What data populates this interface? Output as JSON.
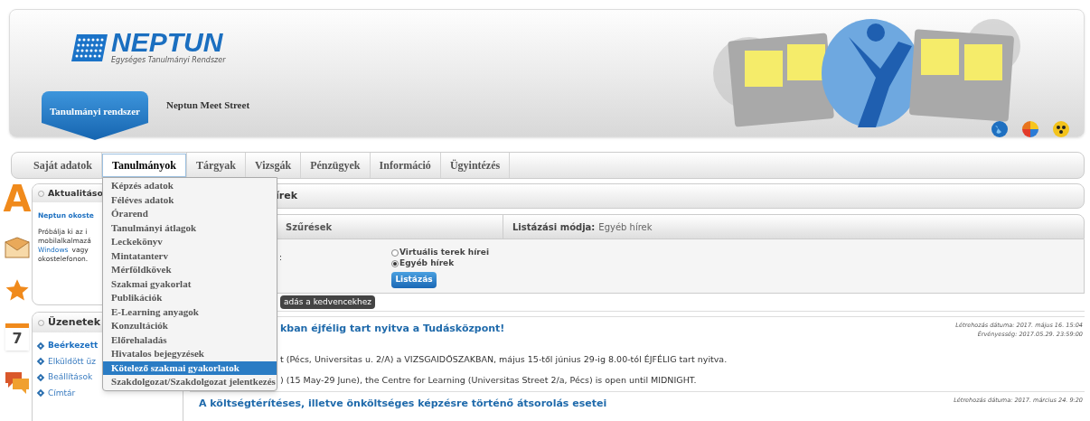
{
  "header": {
    "logo_title": "NEPTUN",
    "logo_subtitle": "Egységes Tanulmányi Rendszer",
    "tabs": [
      {
        "label": "Tanulmányi rendszer",
        "selected": true
      },
      {
        "label": "Neptun Meet Street",
        "selected": false
      }
    ]
  },
  "menu": [
    {
      "label": "Saját adatok",
      "selected": false
    },
    {
      "label": "Tanulmányok",
      "selected": true,
      "items": [
        {
          "label": "Képzés adatok",
          "selected": false
        },
        {
          "label": "Féléves adatok",
          "selected": false
        },
        {
          "label": "Órarend",
          "selected": false
        },
        {
          "label": "Tanulmányi átlagok",
          "selected": false
        },
        {
          "label": "Leckekönyv",
          "selected": false
        },
        {
          "label": "Mintatanterv",
          "selected": false
        },
        {
          "label": "Mérföldkövek",
          "selected": false
        },
        {
          "label": "Szakmai gyakorlat",
          "selected": false
        },
        {
          "label": "Publikációk",
          "selected": false
        },
        {
          "label": "E-Learning anyagok",
          "selected": false
        },
        {
          "label": "Konzultációk",
          "selected": false
        },
        {
          "label": "Előrehaladás",
          "selected": false
        },
        {
          "label": "Hivatalos bejegyzések",
          "selected": false
        },
        {
          "label": "Kötelező szakmai gyakorlatok",
          "selected": true
        },
        {
          "label": "Szakdolgozat/Szakdolgozat jelentkezés",
          "selected": false
        }
      ]
    },
    {
      "label": "Tárgyak",
      "selected": false
    },
    {
      "label": "Vizsgák",
      "selected": false
    },
    {
      "label": "Pénzügyek",
      "selected": false
    },
    {
      "label": "Információ",
      "selected": false
    },
    {
      "label": "Ügyintézés",
      "selected": false
    }
  ],
  "side_icons": [
    {
      "kind": "letter",
      "text": "A"
    },
    {
      "kind": "envelope"
    },
    {
      "kind": "star"
    },
    {
      "kind": "calendar",
      "text": "7"
    },
    {
      "kind": "chat"
    }
  ],
  "news_box": {
    "title": "Aktualitáso",
    "link": "Neptun okoste",
    "lines": [
      "Próbálja ki az i",
      "mobilalkalmazá"
    ],
    "link_word": "Windows",
    "after_link": "vagy",
    "last_line": "okostelefonon."
  },
  "messages": {
    "title": "Üzenetek",
    "items": [
      {
        "label": "Beérkezett",
        "selected": true
      },
      {
        "label": "Elküldött üz",
        "selected": false
      },
      {
        "label": "Beállítások",
        "selected": false
      },
      {
        "label": "Címtár",
        "selected": false
      }
    ]
  },
  "news_panel": {
    "title": "írek",
    "filter_label": "Szűrések",
    "mode_label": "Listázási módja:",
    "mode_value": "Egyéb hírek",
    "field_label": ":",
    "radios": [
      {
        "label": "Virtuális terek hírei",
        "selected": false
      },
      {
        "label": "Egyéb hírek",
        "selected": true
      }
    ],
    "button": "Listázás",
    "tooltip": "adás a kedvencekhez"
  },
  "news": [
    {
      "title": "kban éjfélig tart nyitva a Tudásközpont!",
      "created": "Létrehozás dátuma: 2017. május 16. 15:04",
      "validity": "Érvényesség: 2017.05.29. 23:59:00",
      "paragraphs": [
        "t (Pécs, Universitas u. 2/A) a VIZSGAIDŐSZAKBAN, május 15-től június 29-ig 8.00-tól ÉJFÉLIG tart nyitva.",
        ") (15 May-29 June), the Centre for Learning (Universitas Street 2/a, Pécs) is open until MIDNIGHT."
      ]
    },
    {
      "title": "A költségtérítéses, illetve önköltséges képzésre történő átsorolás esetei",
      "created": "Létrehozás dátuma: 2017. március 24. 9:20"
    }
  ]
}
